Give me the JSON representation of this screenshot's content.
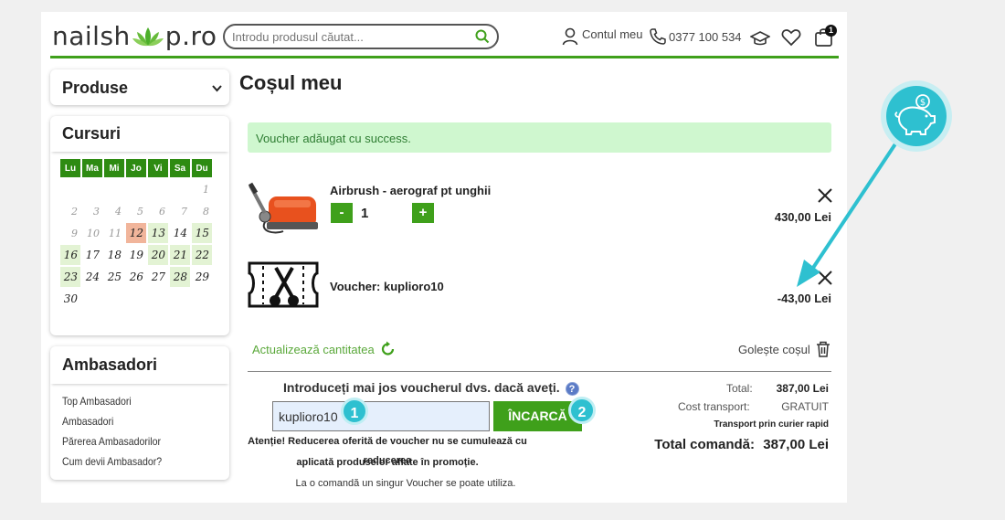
{
  "header": {
    "logo_left": "nailsh",
    "logo_right": "p.ro",
    "search_placeholder": "Introdu produsul căutat...",
    "account_label": "Contul meu",
    "phone": "0377 100 534",
    "cart_count": "1"
  },
  "sidebar": {
    "products_title": "Produse",
    "courses_title": "Cursuri",
    "calendar": {
      "days": [
        "Lu",
        "Ma",
        "Mi",
        "Jo",
        "Vi",
        "Sa",
        "Du"
      ],
      "weeks": [
        [
          "",
          "",
          "",
          "",
          "",
          "",
          "1"
        ],
        [
          "2",
          "3",
          "4",
          "5",
          "6",
          "7",
          "8"
        ],
        [
          "9",
          "10",
          "11",
          "12",
          "13",
          "14",
          "15"
        ],
        [
          "16",
          "17",
          "18",
          "19",
          "20",
          "21",
          "22"
        ],
        [
          "23",
          "24",
          "25",
          "26",
          "27",
          "28",
          "29"
        ],
        [
          "30",
          "",
          "",
          "",
          "",
          "",
          ""
        ]
      ]
    },
    "ambassadors_title": "Ambasadori",
    "ambassadors_links": [
      "Top Ambasadori",
      "Ambasadori",
      "Părerea Ambasadorilor",
      "Cum devii Ambasador?"
    ]
  },
  "main": {
    "title": "Coșul meu",
    "alert": "Voucher adăugat cu success.",
    "items": [
      {
        "name": "Airbrush - aerograf pt unghii",
        "qty": "1",
        "minus": "-",
        "plus": "+",
        "price": "430,00 Lei"
      },
      {
        "name": "Voucher: kuplioro10",
        "price": "-43,00 Lei"
      }
    ],
    "update_qty": "Actualizează cantitatea",
    "empty_cart": "Golește coșul",
    "voucher_title": "Introduceți mai jos voucherul dvs. dacă aveți.",
    "voucher_value": "kuplioro10",
    "voucher_button": "ÎNCARCĂ",
    "note_line1": "Atenție! Reducerea oferită de voucher nu se cumulează cu reducerea",
    "note_line2": "aplicată produselor aflate în promoție.",
    "note_line3": "La o comandă un singur Voucher se poate utiliza.",
    "summary": {
      "total_label": "Total:",
      "total_value": "387,00 Lei",
      "shipping_label": "Cost transport:",
      "shipping_value": "GRATUIT",
      "shipping_method": "Transport prin curier rapid",
      "order_total_label": "Total comandă:",
      "order_total_value": "387,00 Lei"
    }
  },
  "annotations": {
    "badge1": "1",
    "badge2": "2"
  },
  "colors": {
    "accent": "#3fa01b",
    "teal": "#2ec0d0"
  }
}
